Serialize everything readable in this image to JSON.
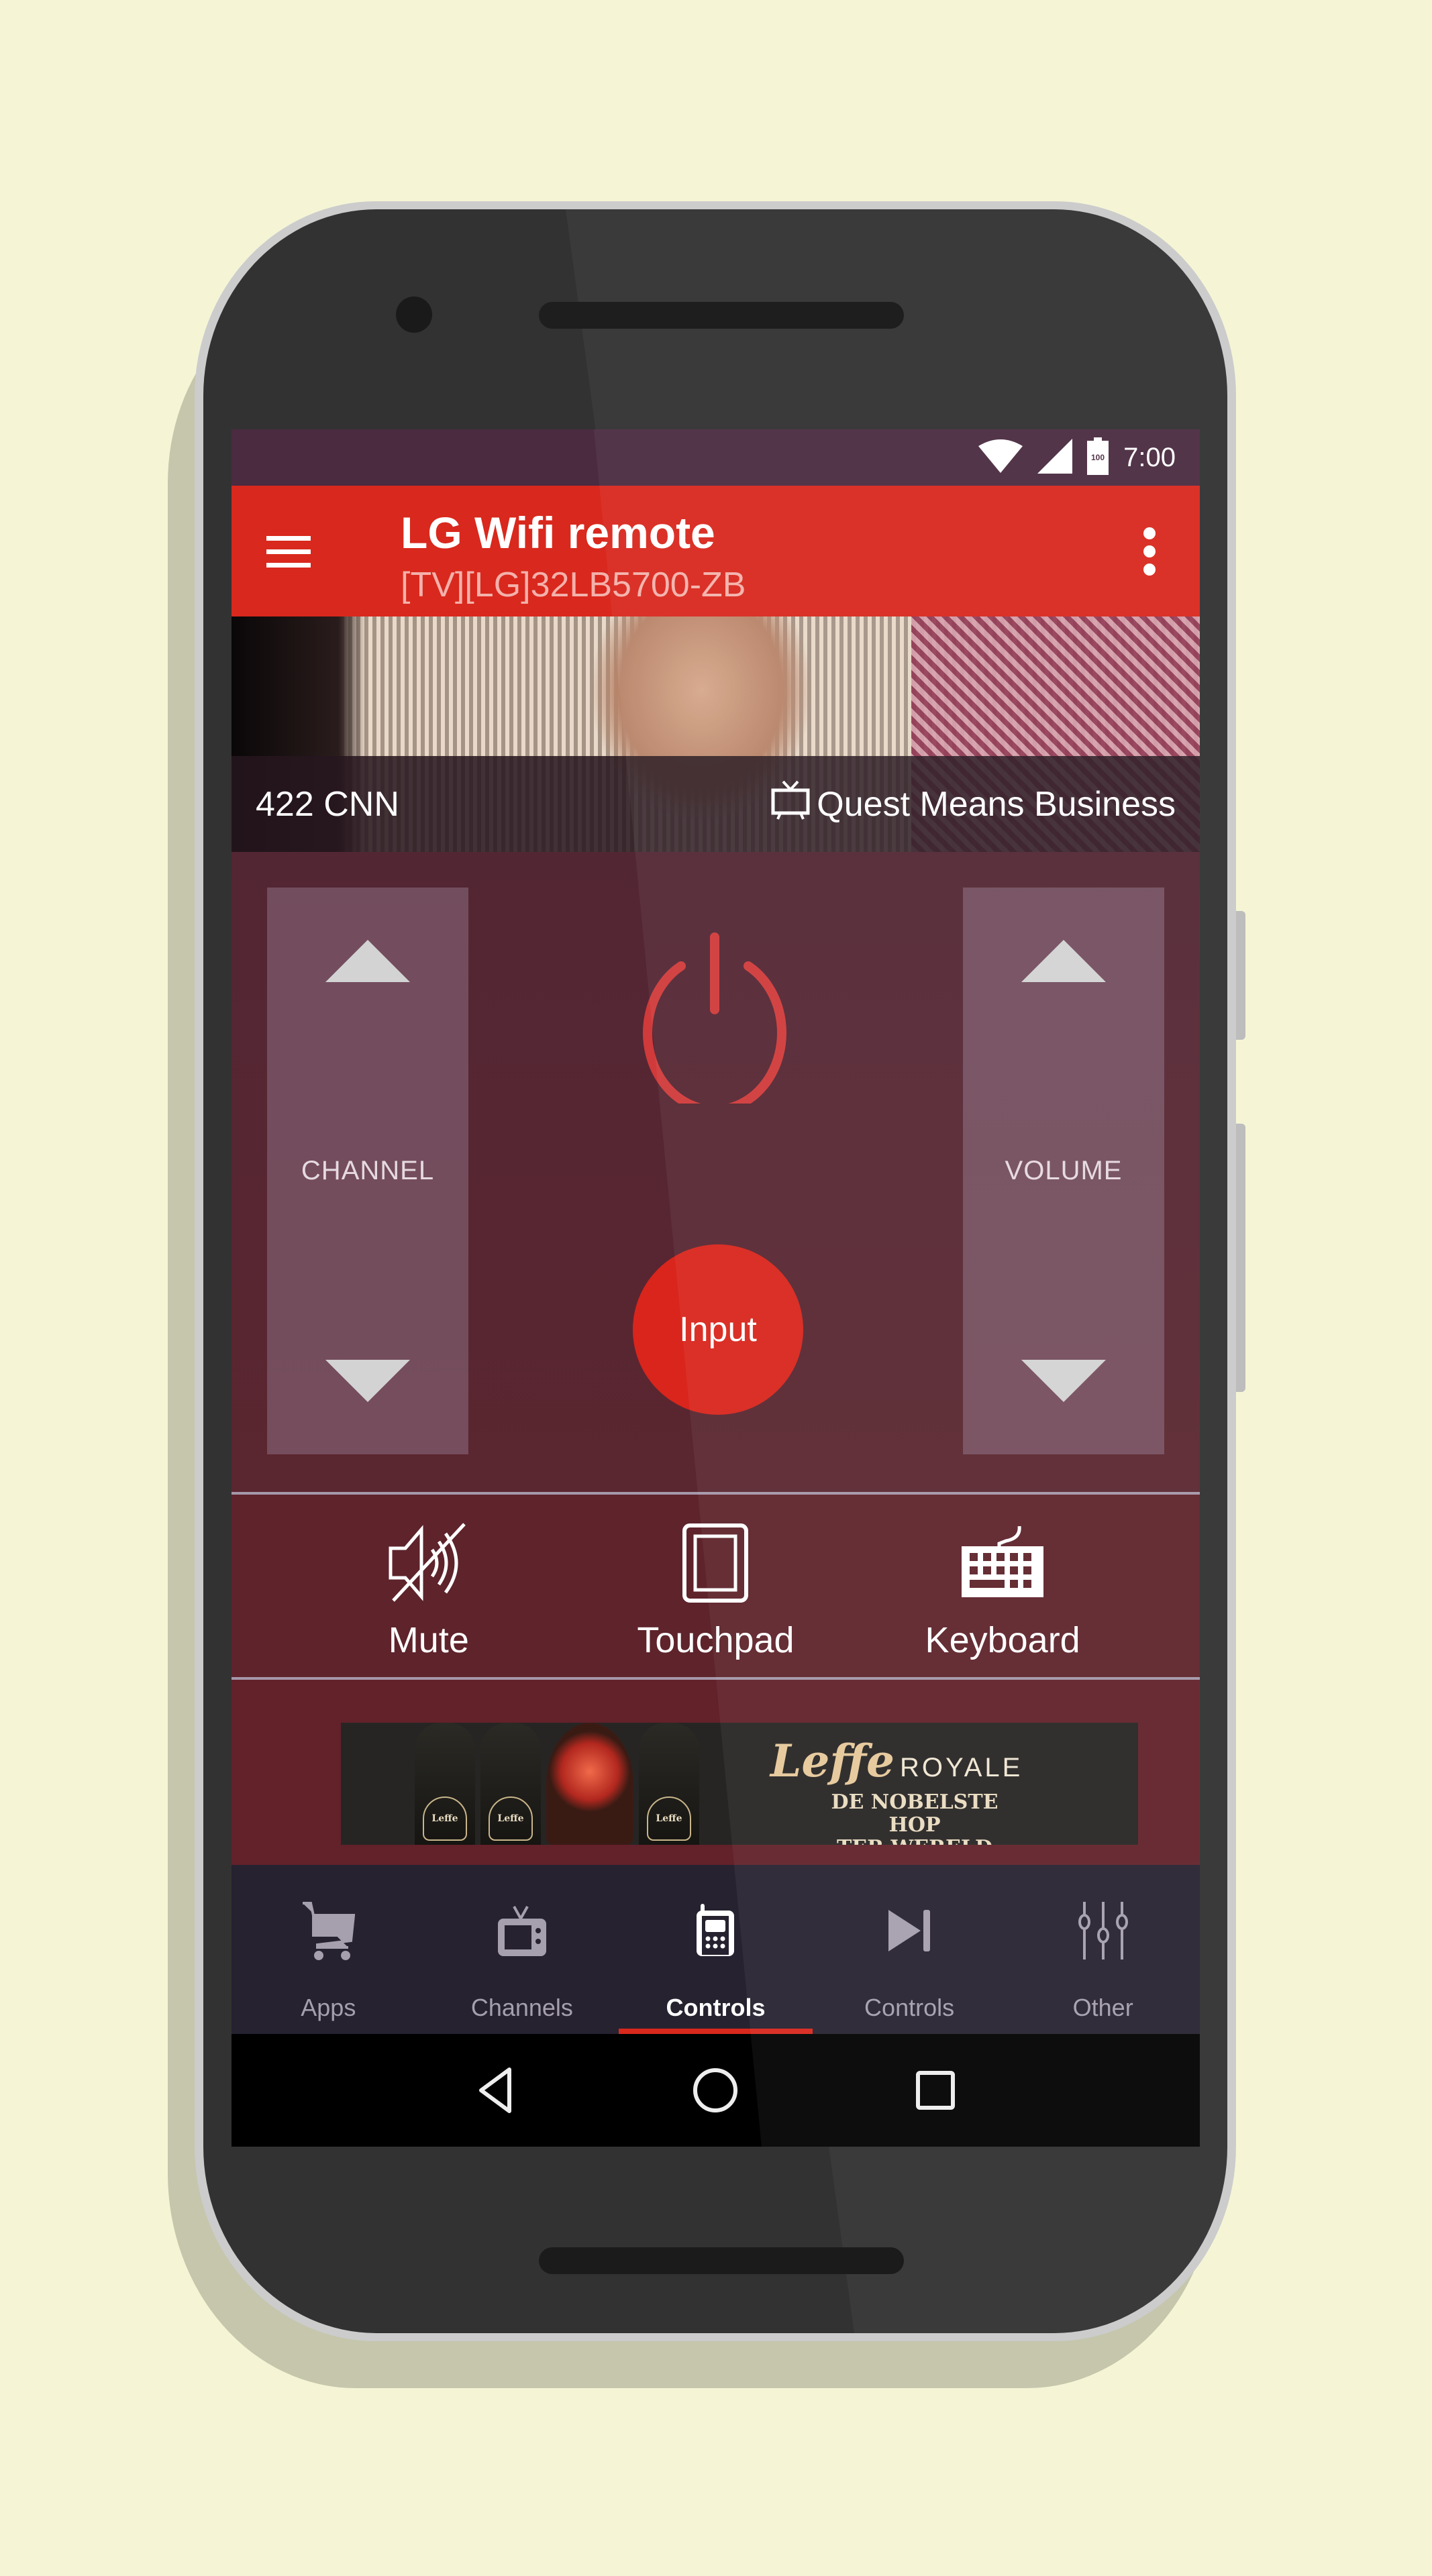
{
  "status_bar": {
    "time": "7:00",
    "battery_level": "100",
    "icons": [
      "wifi-icon",
      "cell-signal-icon",
      "battery-icon"
    ]
  },
  "app_bar": {
    "title": "LG Wifi remote",
    "subtitle": "[TV][LG]32LB5700-ZB",
    "menu_icon": "hamburger-menu-icon",
    "overflow_icon": "more-vert-icon"
  },
  "now_playing": {
    "channel": "422 CNN",
    "program": "Quest Means Business",
    "program_icon": "tv-icon"
  },
  "remote": {
    "channel_label": "CHANNEL",
    "volume_label": "VOLUME",
    "power_icon": "power-icon",
    "input_label": "Input"
  },
  "quick_actions": [
    {
      "label": "Mute",
      "icon": "mute-icon"
    },
    {
      "label": "Touchpad",
      "icon": "touchpad-icon"
    },
    {
      "label": "Keyboard",
      "icon": "keyboard-icon"
    }
  ],
  "ad": {
    "brand": "Leffe",
    "brand_sub": "ROYALE",
    "tagline_line1": "DE NOBELSTE HOP",
    "tagline_line2": "TER WERELD",
    "bottle_label": "Leffe"
  },
  "bottom_nav": {
    "active_index": 2,
    "tabs": [
      {
        "label": "Apps",
        "icon": "cart-icon"
      },
      {
        "label": "Channels",
        "icon": "tv-icon"
      },
      {
        "label": "Controls",
        "icon": "remote-icon"
      },
      {
        "label": "Controls",
        "icon": "skip-next-icon"
      },
      {
        "label": "Other",
        "icon": "sliders-icon"
      }
    ]
  },
  "system_nav": {
    "back_icon": "back-icon",
    "home_icon": "home-icon",
    "recents_icon": "recents-icon"
  },
  "colors": {
    "accent": "#d9281d",
    "status_bar": "#4a2b40",
    "background": "#f5f5d6"
  }
}
